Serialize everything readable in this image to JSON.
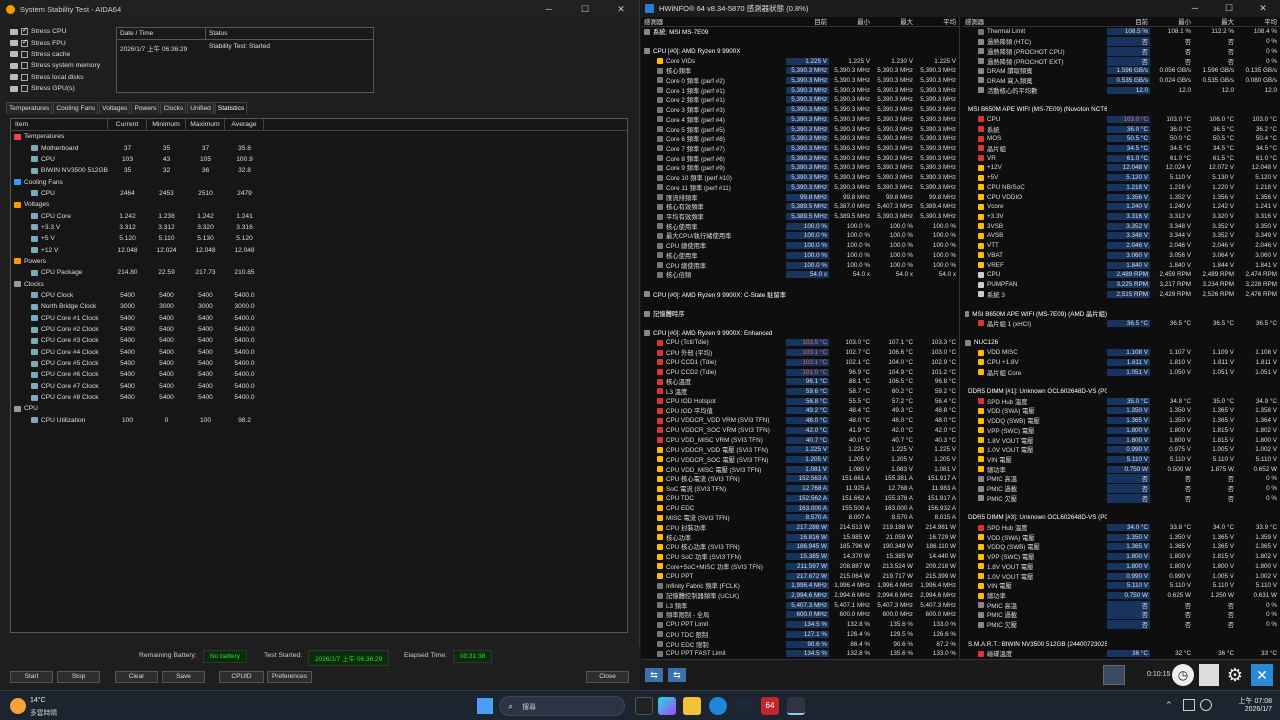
{
  "aida": {
    "title": "System Stability Test - AIDA64",
    "stress": [
      "Stress CPU",
      "Stress FPU",
      "Stress cache",
      "Stress system memory",
      "Stress local disks",
      "Stress GPU(s)"
    ],
    "status_hdr": [
      "Date / Time",
      "Status"
    ],
    "status_row": [
      "2026/1/7 上午 06:36:29",
      "Stability Test: Started"
    ],
    "tabs": [
      "Temperatures",
      "Cooling Fans",
      "Voltages",
      "Powers",
      "Clocks",
      "Unified",
      "Statistics"
    ],
    "grid_hdr": [
      "Item",
      "Current",
      "Minimum",
      "Maximum",
      "Average"
    ],
    "rows": [
      [
        "Temperatures",
        "",
        "",
        "",
        ""
      ],
      [
        "Motherboard",
        "37",
        "35",
        "37",
        "35.8"
      ],
      [
        "CPU",
        "103",
        "43",
        "105",
        "100.9"
      ],
      [
        "BIWIN NV3500 512GB",
        "35",
        "32",
        "36",
        "32.8"
      ],
      [
        "Cooling Fans",
        "",
        "",
        "",
        ""
      ],
      [
        "CPU",
        "2464",
        "2453",
        "2510",
        "2479"
      ],
      [
        "Voltages",
        "",
        "",
        "",
        ""
      ],
      [
        "CPU Core",
        "1.242",
        "1.238",
        "1.242",
        "1.241"
      ],
      [
        "+3.3 V",
        "3.312",
        "3.312",
        "3.320",
        "3.316"
      ],
      [
        "+5 V",
        "5.120",
        "5.110",
        "5.130",
        "5.120"
      ],
      [
        "+12 V",
        "12.048",
        "12.024",
        "12.048",
        "12.048"
      ],
      [
        "Powers",
        "",
        "",
        "",
        ""
      ],
      [
        "CPU Package",
        "214.80",
        "22.59",
        "217.73",
        "210.85"
      ],
      [
        "Clocks",
        "",
        "",
        "",
        ""
      ],
      [
        "CPU Clock",
        "5400",
        "5400",
        "5400",
        "5400.0"
      ],
      [
        "North Bridge Clock",
        "3000",
        "3000",
        "3000",
        "3000.0"
      ],
      [
        "CPU Core #1 Clock",
        "5400",
        "5400",
        "5400",
        "5400.0"
      ],
      [
        "CPU Core #2 Clock",
        "5400",
        "5400",
        "5400",
        "5400.0"
      ],
      [
        "CPU Core #3 Clock",
        "5400",
        "5400",
        "5400",
        "5400.0"
      ],
      [
        "CPU Core #4 Clock",
        "5400",
        "5400",
        "5400",
        "5400.0"
      ],
      [
        "CPU Core #5 Clock",
        "5400",
        "5400",
        "5400",
        "5400.0"
      ],
      [
        "CPU Core #6 Clock",
        "5400",
        "5400",
        "5400",
        "5400.0"
      ],
      [
        "CPU Core #7 Clock",
        "5400",
        "5400",
        "5400",
        "5400.0"
      ],
      [
        "CPU Core #8 Clock",
        "5400",
        "5400",
        "5400",
        "5400.0"
      ],
      [
        "CPU",
        "",
        "",
        "",
        ""
      ],
      [
        "CPU Utilization",
        "100",
        "0",
        "100",
        "98.2"
      ]
    ],
    "remaining_battery_label": "Remaining Battery:",
    "remaining_battery": "No battery",
    "test_started_label": "Test Started:",
    "test_started": "2026/1/7 上午 06:36:29",
    "elapsed_label": "Elapsed Time:",
    "elapsed": "00:31:38",
    "buttons": [
      "Start",
      "Stop",
      "Clear",
      "Save",
      "CPUID",
      "Preferences",
      "Close"
    ]
  },
  "hw": {
    "title": "HWiNFO® 64 v8.34-5870 感測器狀態 (0.8%)",
    "hdr": [
      "感測器",
      "目前",
      "最小",
      "最大",
      "平均"
    ],
    "left": [
      [
        "系統: MSI MS-7E09",
        "",
        "",
        "",
        ""
      ],
      [
        "",
        "",
        " ",
        "",
        ""
      ],
      [
        "CPU [#0]: AMD Ryzen 9 9900X",
        "",
        "",
        "",
        ""
      ],
      [
        "Core VIDs",
        "1.225 V",
        "1.225 V",
        "1.230 V",
        "1.225 V"
      ],
      [
        "核心頻率",
        "5,390.3 MHz",
        "5,390.3 MHz",
        "5,390.3 MHz",
        "5,390.3 MHz"
      ],
      [
        "Core 0 頻率 (perf #2)",
        "5,390.3 MHz",
        "5,390.3 MHz",
        "5,390.3 MHz",
        "5,390.3 MHz"
      ],
      [
        "Core 1 頻率 (perf #1)",
        "5,390.3 MHz",
        "5,390.3 MHz",
        "5,390.3 MHz",
        "5,390.3 MHz"
      ],
      [
        "Core 2 頻率 (perf #1)",
        "5,390.3 MHz",
        "5,390.3 MHz",
        "5,390.3 MHz",
        "5,390.3 MHz"
      ],
      [
        "Core 3 頻率 (perf #3)",
        "5,390.3 MHz",
        "5,390.3 MHz",
        "5,390.3 MHz",
        "5,390.3 MHz"
      ],
      [
        "Core 4 頻率 (perf #4)",
        "5,390.3 MHz",
        "5,390.3 MHz",
        "5,390.3 MHz",
        "5,390.3 MHz"
      ],
      [
        "Core 5 頻率 (perf #5)",
        "5,390.3 MHz",
        "5,390.3 MHz",
        "5,390.3 MHz",
        "5,390.3 MHz"
      ],
      [
        "Core 6 頻率 (perf #8)",
        "5,390.3 MHz",
        "5,390.3 MHz",
        "5,390.3 MHz",
        "5,390.3 MHz"
      ],
      [
        "Core 7 頻率 (perf #7)",
        "5,390.3 MHz",
        "5,390.3 MHz",
        "5,390.3 MHz",
        "5,390.3 MHz"
      ],
      [
        "Core 8 頻率 (perf #6)",
        "5,390.3 MHz",
        "5,390.3 MHz",
        "5,390.3 MHz",
        "5,390.3 MHz"
      ],
      [
        "Core 9 頻率 (perf #9)",
        "5,390.3 MHz",
        "5,390.3 MHz",
        "5,390.3 MHz",
        "5,390.3 MHz"
      ],
      [
        "Core 10 頻率 (perf #10)",
        "5,390.3 MHz",
        "5,390.3 MHz",
        "5,390.3 MHz",
        "5,390.3 MHz"
      ],
      [
        "Core 11 頻率 (perf #11)",
        "5,390.3 MHz",
        "5,390.3 MHz",
        "5,390.3 MHz",
        "5,390.3 MHz"
      ],
      [
        "匯流排頻率",
        "99.8 MHz",
        "99.8 MHz",
        "99.8 MHz",
        "99.8 MHz"
      ],
      [
        "核心有效頻率",
        "5,389.5 MHz",
        "5,387.0 MHz",
        "5,407.3 MHz",
        "5,389.4 MHz"
      ],
      [
        "平均有效頻率",
        "5,389.5 MHz",
        "5,389.5 MHz",
        "5,390.3 MHz",
        "5,390.3 MHz"
      ],
      [
        "核心使用率",
        "100.0 %",
        "100.0 %",
        "100.0 %",
        "100.0 %"
      ],
      [
        "最大CPU/執行緒使用率",
        "100.0 %",
        "100.0 %",
        "100.0 %",
        "100.0 %"
      ],
      [
        "CPU 總使用率",
        "100.0 %",
        "100.0 %",
        "100.0 %",
        "100.0 %"
      ],
      [
        "核心使用率",
        "100.0 %",
        "100.0 %",
        "100.0 %",
        "100.0 %"
      ],
      [
        "CPU 總使用率",
        "100.0 %",
        "100.0 %",
        "100.0 %",
        "100.0 %"
      ],
      [
        "核心倍頻",
        "54.0 x",
        "54.0 x",
        "54.0 x",
        "54.0 x"
      ],
      [
        "",
        "",
        " ",
        "",
        ""
      ],
      [
        "CPU [#0]: AMD Ryzen 9 9900X: C-State 駐留率",
        "",
        "",
        "",
        ""
      ],
      [
        "",
        "",
        " ",
        "",
        ""
      ],
      [
        "記憶體時序",
        "",
        "",
        "",
        ""
      ],
      [
        "",
        "",
        " ",
        "",
        ""
      ],
      [
        "CPU [#0]: AMD Ryzen 9 9900X: Enhanced",
        "",
        "",
        "",
        ""
      ],
      [
        "CPU (Tctl/Tdie)",
        "103.5 °C",
        "103.0 °C",
        "107.1 °C",
        "103.3 °C"
      ],
      [
        "CPU 外殼 (平均)",
        "103.1 °C",
        "102.7 °C",
        "106.6 °C",
        "103.0 °C"
      ],
      [
        "CPU CCD1 (Tdie)",
        "103.1 °C",
        "102.1 °C",
        "104.0 °C",
        "102.9 °C"
      ],
      [
        "CPU CCD2 (Tdie)",
        "101.0 °C",
        "96.9 °C",
        "104.9 °C",
        "101.2 °C"
      ],
      [
        "核心溫度",
        "96.1 °C",
        "88.1 °C",
        "106.5 °C",
        "96.8 °C"
      ],
      [
        "L3 溫度",
        "59.6 °C",
        "58.7 °C",
        "60.2 °C",
        "59.2 °C"
      ],
      [
        "CPU IOD Hotspot",
        "56.8 °C",
        "55.5 °C",
        "57.2 °C",
        "56.4 °C"
      ],
      [
        "CPU IOD 平均值",
        "49.2 °C",
        "48.4 °C",
        "49.3 °C",
        "48.8 °C"
      ],
      [
        "CPU VDDCR_VDD VRM (SVI3 TFN)",
        "48.0 °C",
        "48.0 °C",
        "48.0 °C",
        "48.0 °C"
      ],
      [
        "CPU VDDCR_SOC VRM (SVI3 TFN)",
        "42.0 °C",
        "41.9 °C",
        "42.0 °C",
        "42.0 °C"
      ],
      [
        "CPU VDD_MISC VRM (SVI3 TFN)",
        "40.7 °C",
        "40.0 °C",
        "40.7 °C",
        "40.3 °C"
      ],
      [
        "CPU VDDCR_VDD 電壓 (SVI3 TFN)",
        "1.225 V",
        "1.225 V",
        "1.225 V",
        "1.225 V"
      ],
      [
        "CPU VDDCR_SOC 電壓 (SVI3 TFN)",
        "1.205 V",
        "1.205 V",
        "1.205 V",
        "1.205 V"
      ],
      [
        "CPU VDD_MISC 電壓 (SVI3 TFN)",
        "1.081 V",
        "1.080 V",
        "1.083 V",
        "1.081 V"
      ],
      [
        "CPU 核心電流 (SVI3 TFN)",
        "152.563 A",
        "151.661 A",
        "155.381 A",
        "151.917 A"
      ],
      [
        "SoC 電流 (SVI3 TFN)",
        "12.768 A",
        "11.925 A",
        "12.768 A",
        "11.983 A"
      ],
      [
        "CPU TDC",
        "152.562 A",
        "151.662 A",
        "155.378 A",
        "151.917 A"
      ],
      [
        "CPU EDC",
        "163.000 A",
        "155.500 A",
        "163.000 A",
        "156.932 A"
      ],
      [
        "MISC 電流 (SVI3 TFN)",
        "8.570 A",
        "8.007 A",
        "8.570 A",
        "8.015 A"
      ],
      [
        "CPU 封裝功率",
        "217.288 W",
        "214.513 W",
        "219.188 W",
        "214.981 W"
      ],
      [
        "核心功率",
        "16.816 W",
        "15.985 W",
        "21.059 W",
        "16.729 W"
      ],
      [
        "CPU 核心功率 (SVI3 TFN)",
        "186.945 W",
        "185.796 W",
        "190.349 W",
        "186.110 W"
      ],
      [
        "CPU SoC 功率 (SVI3 TFN)",
        "15.385 W",
        "14.370 W",
        "15.385 W",
        "14.440 W"
      ],
      [
        "Core+SoC+MISC 功率 (SVI3 TFN)",
        "211.597 W",
        "208.887 W",
        "213.524 W",
        "209.218 W"
      ],
      [
        "CPU PPT",
        "217.872 W",
        "215.064 W",
        "219.717 W",
        "215.399 W"
      ],
      [
        "Infinity Fabric 頻率 (FCLK)",
        "1,996.4 MHz",
        "1,996.4 MHz",
        "1,996.4 MHz",
        "1,996.4 MHz"
      ],
      [
        "記憶體控制器頻率 (UCLK)",
        "2,994.6 MHz",
        "2,994.6 MHz",
        "2,994.6 MHz",
        "2,994.6 MHz"
      ],
      [
        "L3 頻率",
        "5,407.3 MHz",
        "5,407.1 MHz",
        "5,407.3 MHz",
        "5,407.3 MHz"
      ],
      [
        "頻率限制 - 全局",
        "600.0 MHz",
        "600.0 MHz",
        "600.0 MHz",
        "600.0 MHz"
      ],
      [
        "CPU PPT Limit",
        "134.5 %",
        "132.8 %",
        "135.6 %",
        "133.0 %"
      ],
      [
        "CPU TDC 限制",
        "127.1 %",
        "126.4 %",
        "129.5 %",
        "126.6 %"
      ],
      [
        "CPU EDC 限制",
        "90.6 %",
        "86.4 %",
        "90.6 %",
        "87.2 %"
      ],
      [
        "CPU PPT FAST Limit",
        "134.5 %",
        "132.8 %",
        "135.6 %",
        "133.0 %"
      ]
    ],
    "right": [
      [
        "Thermal Limit",
        "108.5 %",
        "108.1 %",
        "112.2 %",
        "108.4 %"
      ],
      [
        "過熱降頻 (HTC)",
        "否",
        "否",
        "否",
        "0 %"
      ],
      [
        "過熱降頻 (PROCHOT CPU)",
        "否",
        "否",
        "否",
        "0 %"
      ],
      [
        "過熱降頻 (PROCHOT EXT)",
        "否",
        "否",
        "否",
        "0 %"
      ],
      [
        "DRAM 讀取頻寬",
        "1.596 GB/s",
        "0.056 GB/s",
        "1.596 GB/s",
        "0.135 GB/s"
      ],
      [
        "DRAM 寫入頻寬",
        "0.535 GB/s",
        "0.024 GB/s",
        "0.535 GB/s",
        "0.080 GB/s"
      ],
      [
        "活動核心的平均數",
        "12.0",
        "12.0",
        "12.0",
        "12.0"
      ],
      [
        "",
        "",
        " ",
        "",
        ""
      ],
      [
        "MSI B650M APE WIFI (MS-7E09) (Nuvoton NCT6687D)",
        "",
        "",
        "",
        ""
      ],
      [
        "CPU",
        "103.0 °C",
        "103.0 °C",
        "106.0 °C",
        "103.0 °C"
      ],
      [
        "系統",
        "36.0 °C",
        "36.0 °C",
        "36.5 °C",
        "36.2 °C"
      ],
      [
        "MOS",
        "50.5 °C",
        "50.0 °C",
        "50.5 °C",
        "50.4 °C"
      ],
      [
        "晶片組",
        "34.5 °C",
        "34.5 °C",
        "34.5 °C",
        "34.5 °C"
      ],
      [
        "VR",
        "61.0 °C",
        "61.0 °C",
        "61.5 °C",
        "61.0 °C"
      ],
      [
        "+12V",
        "12.048 V",
        "12.024 V",
        "12.072 V",
        "12.048 V"
      ],
      [
        "+5V",
        "5.120 V",
        "5.110 V",
        "5.130 V",
        "5.120 V"
      ],
      [
        "CPU NB/SoC",
        "1.218 V",
        "1.216 V",
        "1.220 V",
        "1.218 V"
      ],
      [
        "CPU VDDIO",
        "1.356 V",
        "1.352 V",
        "1.356 V",
        "1.356 V"
      ],
      [
        "Vcore",
        "1.240 V",
        "1.240 V",
        "1.242 V",
        "1.241 V"
      ],
      [
        "+3.3V",
        "3.316 V",
        "3.312 V",
        "3.320 V",
        "3.316 V"
      ],
      [
        "3VSB",
        "3.352 V",
        "3.348 V",
        "3.352 V",
        "3.350 V"
      ],
      [
        "AVSB",
        "3.348 V",
        "3.344 V",
        "3.352 V",
        "3.349 V"
      ],
      [
        "VTT",
        "2.046 V",
        "2.046 V",
        "2.046 V",
        "2.046 V"
      ],
      [
        "VBAT",
        "3.060 V",
        "3.056 V",
        "3.064 V",
        "3.060 V"
      ],
      [
        "VREF",
        "1.840 V",
        "1.840 V",
        "1.844 V",
        "1.841 V"
      ],
      [
        "CPU",
        "2,489 RPM",
        "2,459 RPM",
        "2,489 RPM",
        "2,474 RPM"
      ],
      [
        "PUMPFAN",
        "3,225 RPM",
        "3,217 RPM",
        "3,234 RPM",
        "3,228 RPM"
      ],
      [
        "系統 3",
        "2,515 RPM",
        "2,429 RPM",
        "2,526 RPM",
        "2,476 RPM"
      ],
      [
        "",
        "",
        " ",
        "",
        ""
      ],
      [
        "MSI B650M APE WIFI (MS-7E09) (AMD 晶片組)",
        "",
        "",
        "",
        ""
      ],
      [
        "晶片組 1 (xHCI)",
        "36.5 °C",
        "36.5 °C",
        "36.5 °C",
        "36.5 °C"
      ],
      [
        "",
        "",
        " ",
        "",
        ""
      ],
      [
        "NUC126",
        "",
        "",
        "",
        ""
      ],
      [
        "VDD MISC",
        "1.108 V",
        "1.107 V",
        "1.109 V",
        "1.108 V"
      ],
      [
        "CPU +1.8V",
        "1.811 V",
        "1.810 V",
        "1.811 V",
        "1.811 V"
      ],
      [
        "晶片組 Core",
        "1.051 V",
        "1.050 V",
        "1.051 V",
        "1.051 V"
      ],
      [
        "",
        "",
        " ",
        "",
        ""
      ],
      [
        "DDR5 DIMM [#1]: Unknown OCL602648D-VS (P0 CHANNEL A/DIMM A2)",
        "",
        "",
        "",
        ""
      ],
      [
        "SPD Hub 溫度",
        "35.0 °C",
        "34.8 °C",
        "35.0 °C",
        "34.9 °C"
      ],
      [
        "VDD (SWA) 電壓",
        "1.350 V",
        "1.350 V",
        "1.365 V",
        "1.358 V"
      ],
      [
        "VDDQ (SWB) 電壓",
        "1.365 V",
        "1.350 V",
        "1.365 V",
        "1.364 V"
      ],
      [
        "VPP (SWC) 電壓",
        "1.800 V",
        "1.800 V",
        "1.815 V",
        "1.802 V"
      ],
      [
        "1.8V VOUT 電壓",
        "1.800 V",
        "1.800 V",
        "1.815 V",
        "1.800 V"
      ],
      [
        "1.0V VOUT 電壓",
        "0.990 V",
        "0.975 V",
        "1.005 V",
        "1.002 V"
      ],
      [
        "VIN 電壓",
        "5.110 V",
        "5.110 V",
        "5.110 V",
        "5.110 V"
      ],
      [
        "總功率",
        "0.750 W",
        "0.500 W",
        "1.875 W",
        "0.652 W"
      ],
      [
        "PMIC 高溫",
        "否",
        "否",
        "否",
        "0 %"
      ],
      [
        "PMIC 過載",
        "否",
        "否",
        "否",
        "0 %"
      ],
      [
        "PMIC 欠壓",
        "否",
        "否",
        "否",
        "0 %"
      ],
      [
        "",
        "",
        " ",
        "",
        ""
      ],
      [
        "DDR5 DIMM [#3]: Unknown OCL602648D-VS (P0 CHANNEL B/DIMM B2)",
        "",
        "",
        "",
        ""
      ],
      [
        "SPD Hub 溫度",
        "34.0 °C",
        "33.8 °C",
        "34.0 °C",
        "33.9 °C"
      ],
      [
        "VDD (SWA) 電壓",
        "1.350 V",
        "1.350 V",
        "1.365 V",
        "1.359 V"
      ],
      [
        "VDDQ (SWB) 電壓",
        "1.365 V",
        "1.365 V",
        "1.365 V",
        "1.365 V"
      ],
      [
        "VPP (SWC) 電壓",
        "1.800 V",
        "1.800 V",
        "1.815 V",
        "1.802 V"
      ],
      [
        "1.8V VOUT 電壓",
        "1.800 V",
        "1.800 V",
        "1.800 V",
        "1.800 V"
      ],
      [
        "1.0V VOUT 電壓",
        "0.990 V",
        "0.990 V",
        "1.005 V",
        "1.002 V"
      ],
      [
        "VIN 電壓",
        "5.110 V",
        "5.110 V",
        "5.110 V",
        "5.110 V"
      ],
      [
        "總功率",
        "0.750 W",
        "0.625 W",
        "1.250 W",
        "0.631 W"
      ],
      [
        "PMIC 高溫",
        "否",
        "否",
        "否",
        "0 %"
      ],
      [
        "PMIC 過載",
        "否",
        "否",
        "否",
        "0 %"
      ],
      [
        "PMIC 欠壓",
        "否",
        "否",
        "否",
        "0 %"
      ],
      [
        "",
        "",
        " ",
        "",
        ""
      ],
      [
        "S.M.A.R.T.: BIWIN NV3500 512GB (2440072302511) (C:)",
        "",
        "",
        "",
        ""
      ],
      [
        "磁碟溫度",
        "36 °C",
        "32 °C",
        "36 °C",
        "33 °C"
      ]
    ],
    "elapsed": "0:10:15"
  },
  "taskbar": {
    "weather_temp": "14°C",
    "weather_desc": "多雲時晴",
    "search": "搜尋",
    "time": "上午 07:08",
    "date": "2026/1/7"
  }
}
